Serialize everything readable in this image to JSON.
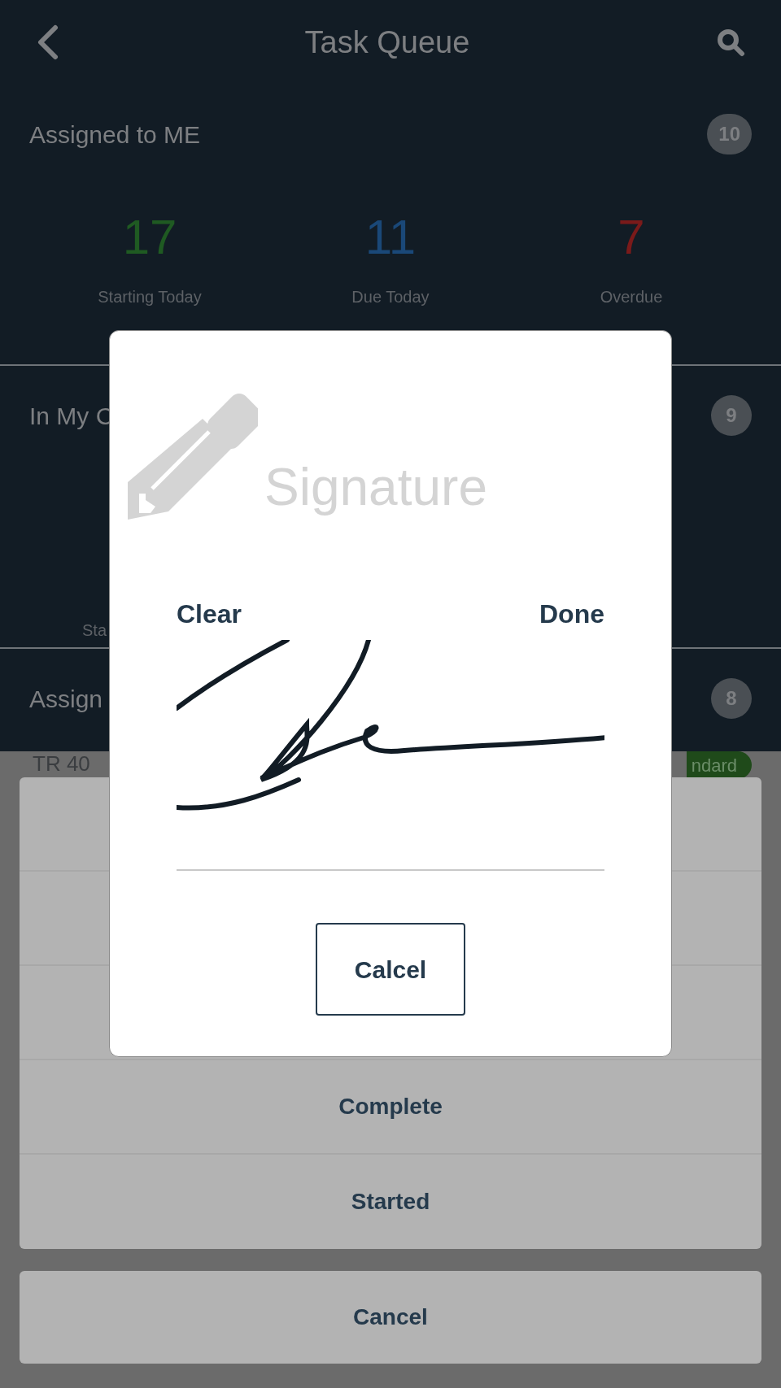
{
  "header": {
    "title": "Task Queue"
  },
  "sections": [
    {
      "title": "Assigned to ME",
      "count": "10",
      "stats": [
        {
          "value": "17",
          "label": "Starting Today",
          "color": "#1f5a22"
        },
        {
          "value": "11",
          "label": "Due Today",
          "color": "#1a4878"
        },
        {
          "value": "7",
          "label": "Overdue",
          "color": "#7a1a1a"
        }
      ]
    },
    {
      "title": "In My C",
      "count": "9",
      "stats": [
        {
          "label": "Sta"
        }
      ]
    },
    {
      "title": "Assign",
      "count": "8"
    }
  ],
  "task_row": {
    "title": "TR 40",
    "tag": "ndard"
  },
  "action_sheet": {
    "options": [
      "Complete",
      "Started"
    ],
    "cancel": "Cancel"
  },
  "dialog": {
    "title": "Signature",
    "clear": "Clear",
    "done": "Done",
    "button": "Calcel"
  }
}
